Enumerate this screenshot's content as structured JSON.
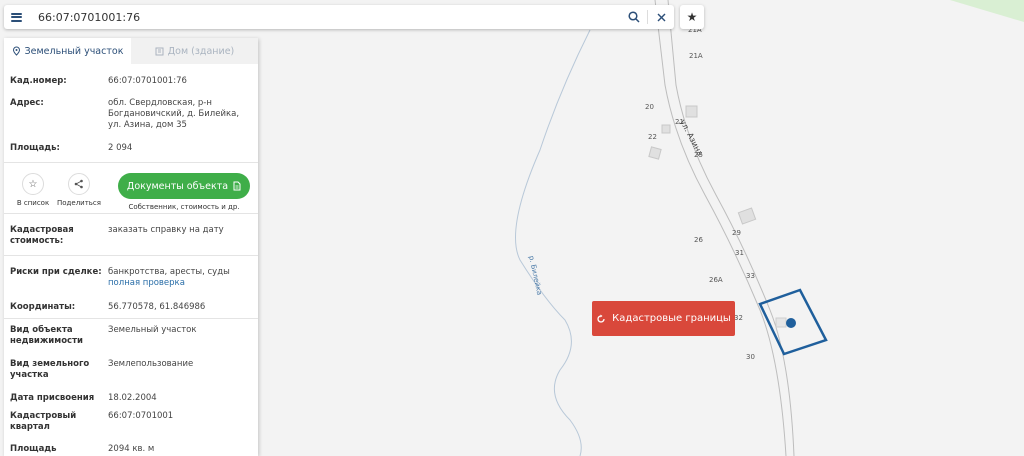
{
  "search": {
    "value": "66:07:0701001:76",
    "placeholder": ""
  },
  "tabs": [
    {
      "label": "Земельный участок",
      "active": true,
      "icon": "map-pin-icon"
    },
    {
      "label": "Дом (здание)",
      "active": false,
      "icon": "building-icon"
    }
  ],
  "info": {
    "cad_number_label": "Кад.номер:",
    "cad_number": "66:07:0701001:76",
    "address_label": "Адрес:",
    "address": "обл. Свердловская, р-н Богдановичский, д. Билейка, ул. Азина, дом 35",
    "area_label": "Площадь:",
    "area": "2 094",
    "cad_value_label": "Кадастровая стоимость:",
    "cad_value_link": "заказать справку на дату",
    "risks_label": "Риски при сделке:",
    "risks_text": "банкротства, аресты, суды",
    "risks_link": "полная проверка",
    "coords_label": "Координаты:",
    "coords": "56.770578, 61.846986",
    "object_type_label": "Вид объекта недвижимости",
    "object_type": "Земельный участок",
    "land_type_label": "Вид земельного участка",
    "land_type": "Землепользование",
    "date_label": "Дата присвоения",
    "date": "18.02.2004",
    "quarter_label": "Кадастровый квартал",
    "quarter": "66:07:0701001",
    "area_refined_label": "Площадь уточненная",
    "area_refined": "2094 кв. м"
  },
  "actions": {
    "to_list": "В список",
    "share": "Поделиться",
    "docs_button": "Документы объекта",
    "docs_sub": "Собственник, стоимость и др."
  },
  "map": {
    "cadastral_button": "Кадастровые границы",
    "street": "ул. Азина",
    "river": "р. Билейка",
    "house_numbers": [
      "21А",
      "20",
      "21",
      "22",
      "23",
      "25",
      "29",
      "26",
      "31",
      "33",
      "26А",
      "30",
      "32"
    ]
  },
  "colors": {
    "accent": "#2c4f78",
    "link": "#2a6ea8",
    "docs_green": "#3fae49",
    "cadastral_red": "#d9483b",
    "parcel_blue": "#1f5f9c"
  }
}
